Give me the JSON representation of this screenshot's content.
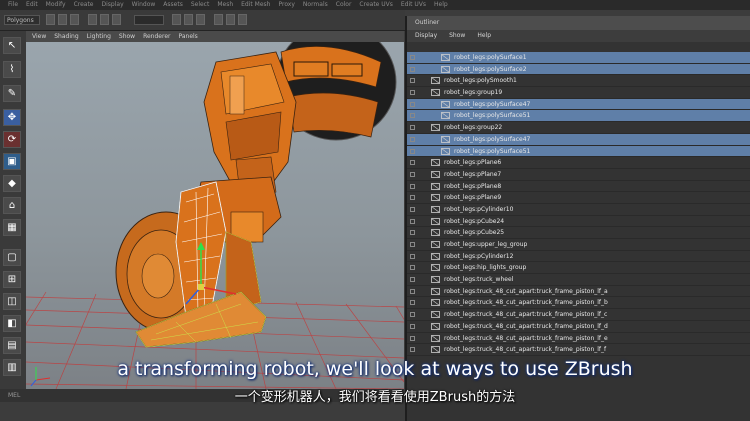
{
  "menubar": {
    "items": [
      "File",
      "Edit",
      "Modify",
      "Create",
      "Display",
      "Window",
      "Assets",
      "Select",
      "Mesh",
      "Edit Mesh",
      "Proxy",
      "Normals",
      "Color",
      "Create UVs",
      "Edit UVs",
      "Help"
    ]
  },
  "toolbar": {
    "mode": "Polygons"
  },
  "viewport": {
    "menu": [
      "View",
      "Shading",
      "Lighting",
      "Show",
      "Renderer",
      "Panels"
    ],
    "status": "MEL"
  },
  "outliner": {
    "title": "Outliner",
    "menu": [
      "Display",
      "Show",
      "Help"
    ],
    "rows": [
      {
        "label": "robot_legs:polySurface1",
        "selected": true,
        "indent": 1
      },
      {
        "label": "robot_legs:polySurface2",
        "selected": true,
        "indent": 1
      },
      {
        "label": "robot_legs:polySmooth1",
        "selected": false,
        "indent": 0
      },
      {
        "label": "robot_legs:group19",
        "selected": false,
        "indent": 0
      },
      {
        "label": "robot_legs:polySurface47",
        "selected": true,
        "indent": 1
      },
      {
        "label": "robot_legs:polySurface51",
        "selected": true,
        "indent": 1
      },
      {
        "label": "robot_legs:group22",
        "selected": false,
        "indent": 0
      },
      {
        "label": "robot_legs:polySurface47",
        "selected": true,
        "indent": 1
      },
      {
        "label": "robot_legs:polySurface51",
        "selected": true,
        "indent": 1
      },
      {
        "label": "robot_legs:pPlane6",
        "selected": false,
        "indent": 0
      },
      {
        "label": "robot_legs:pPlane7",
        "selected": false,
        "indent": 0
      },
      {
        "label": "robot_legs:pPlane8",
        "selected": false,
        "indent": 0
      },
      {
        "label": "robot_legs:pPlane9",
        "selected": false,
        "indent": 0
      },
      {
        "label": "robot_legs:pCylinder10",
        "selected": false,
        "indent": 0
      },
      {
        "label": "robot_legs:pCube24",
        "selected": false,
        "indent": 0
      },
      {
        "label": "robot_legs:pCube25",
        "selected": false,
        "indent": 0
      },
      {
        "label": "robot_legs:upper_leg_group",
        "selected": false,
        "indent": 0
      },
      {
        "label": "robot_legs:pCylinder12",
        "selected": false,
        "indent": 0
      },
      {
        "label": "robot_legs:hip_lights_group",
        "selected": false,
        "indent": 0
      },
      {
        "label": "robot_legs:truck_wheel",
        "selected": false,
        "indent": 0
      },
      {
        "label": "robot_legs:truck_48_cut_apart:truck_frame_piston_lf_a",
        "selected": false,
        "indent": 0
      },
      {
        "label": "robot_legs:truck_48_cut_apart:truck_frame_piston_lf_b",
        "selected": false,
        "indent": 0
      },
      {
        "label": "robot_legs:truck_48_cut_apart:truck_frame_piston_lf_c",
        "selected": false,
        "indent": 0
      },
      {
        "label": "robot_legs:truck_48_cut_apart:truck_frame_piston_lf_d",
        "selected": false,
        "indent": 0
      },
      {
        "label": "robot_legs:truck_48_cut_apart:truck_frame_piston_lf_e",
        "selected": false,
        "indent": 0
      },
      {
        "label": "robot_legs:truck_48_cut_apart:truck_frame_piston_lf_f",
        "selected": false,
        "indent": 0
      }
    ]
  },
  "subtitles": {
    "english": "a transforming robot, we'll look at ways to use ZBrush",
    "chinese": "一个变形机器人，我们将看看使用ZBrush的方法"
  },
  "colors": {
    "selection": "#5f7fa8",
    "robot": "#d9721c",
    "grid": "#c23a3a",
    "subtitle_outline": "#1b3a80"
  }
}
